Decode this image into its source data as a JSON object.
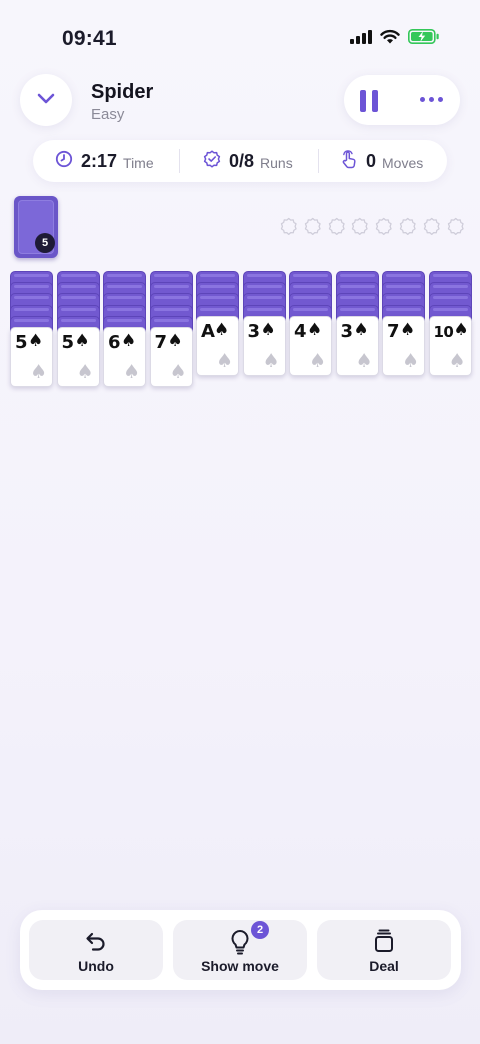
{
  "status_bar": {
    "time": "09:41"
  },
  "header": {
    "title": "Spider",
    "subtitle": "Easy"
  },
  "stats": {
    "time_value": "2:17",
    "time_label": "Time",
    "runs_value": "0/8",
    "runs_label": "Runs",
    "moves_value": "0",
    "moves_label": "Moves"
  },
  "stock": {
    "count": "5"
  },
  "foundation_slots": 8,
  "tableau": [
    {
      "facedown": 5,
      "rank": "5",
      "suit": "♠"
    },
    {
      "facedown": 5,
      "rank": "5",
      "suit": "♠"
    },
    {
      "facedown": 5,
      "rank": "6",
      "suit": "♠"
    },
    {
      "facedown": 5,
      "rank": "7",
      "suit": "♠"
    },
    {
      "facedown": 4,
      "rank": "A",
      "suit": "♠"
    },
    {
      "facedown": 4,
      "rank": "3",
      "suit": "♠"
    },
    {
      "facedown": 4,
      "rank": "4",
      "suit": "♠"
    },
    {
      "facedown": 4,
      "rank": "3",
      "suit": "♠"
    },
    {
      "facedown": 4,
      "rank": "7",
      "suit": "♠"
    },
    {
      "facedown": 4,
      "rank": "10",
      "suit": "♠"
    }
  ],
  "toolbar": {
    "undo_label": "Undo",
    "show_move_label": "Show move",
    "show_move_badge": "2",
    "deal_label": "Deal"
  },
  "colors": {
    "accent": "#6c54d6",
    "card_back": "#7259d0"
  }
}
